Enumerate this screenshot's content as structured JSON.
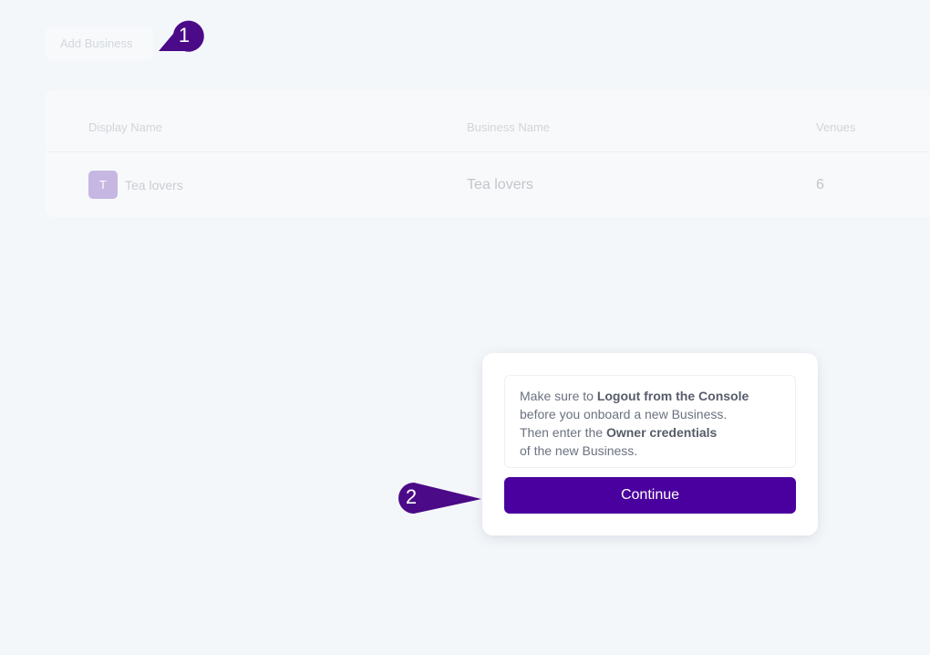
{
  "toolbar": {
    "add_business_label": "Add Business"
  },
  "markers": [
    {
      "number": "1",
      "color": "#4b0a87"
    },
    {
      "number": "2",
      "color": "#4b0a87"
    }
  ],
  "table": {
    "columns": [
      "Display Name",
      "Business Name",
      "Venues"
    ],
    "rows": [
      {
        "avatar_letter": "T",
        "display_name": "Tea lovers",
        "business_name": "Tea lovers",
        "venues": "6"
      }
    ]
  },
  "popup": {
    "line1_prefix": "Make sure to ",
    "line1_bold": "Logout from the Console",
    "line2": "before you onboard a new Business.",
    "line3_prefix": "Then enter the ",
    "line3_bold": "Owner credentials",
    "line4": "of the new Business.",
    "continue_label": "Continue"
  },
  "colors": {
    "accent": "#4a009e",
    "marker": "#4b0a87",
    "avatar": "#c6b7e2",
    "background": "#f4f7fa"
  }
}
